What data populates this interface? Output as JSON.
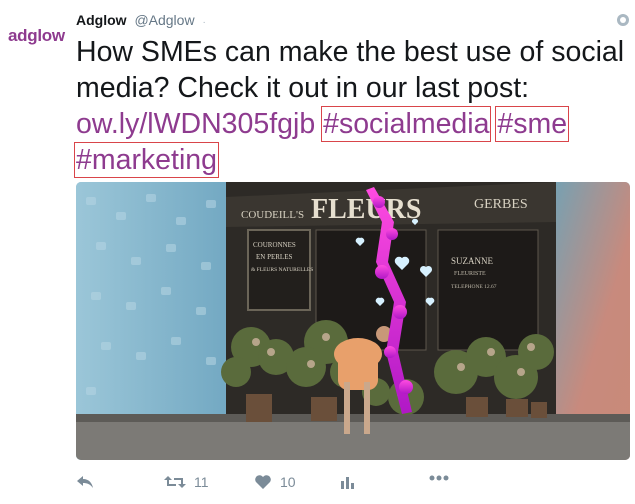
{
  "brand": {
    "logo_text": "adglow",
    "accent": "#8e3b8f"
  },
  "tweet": {
    "author_name": "Adglow",
    "author_handle": "@Adglow",
    "separator": "·",
    "text_main": "How SMEs can make the best use of social media? Check it out in our last post:",
    "link": "ow.ly/lWDN305fgjb",
    "hashtags": [
      "#socialmedia",
      "#sme",
      "#marketing"
    ]
  },
  "media": {
    "shop_sign": "FLEURS",
    "left_sign": "COUDEILL'S",
    "right_sign": "GERBES",
    "board_lines": [
      "COURONNES",
      "EN PERLES",
      "& FLEURS NATURELLES"
    ],
    "shop_name": "SUZANNE",
    "shop_sub": "FLEURISTE",
    "phone": "TELEPHONE 12.67"
  },
  "actions": {
    "retweets": "11",
    "likes": "10"
  },
  "icons": [
    "globe-icon",
    "reply-icon",
    "retweet-icon",
    "like-icon",
    "analytics-icon",
    "more-icon"
  ]
}
